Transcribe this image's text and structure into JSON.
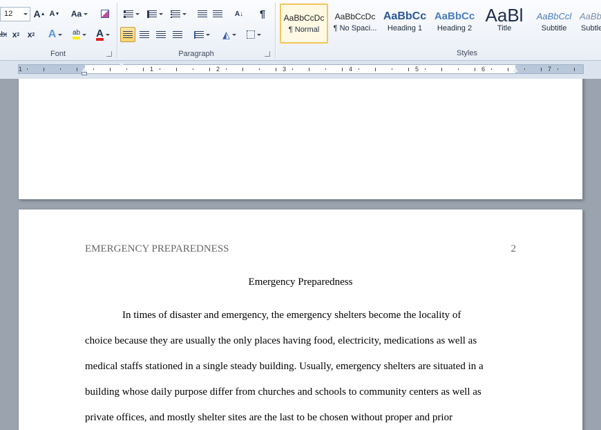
{
  "font_group": {
    "font_size": "12",
    "label": "Font",
    "grow_font": "A",
    "shrink_font": "A",
    "change_case": "Aa",
    "strike": "abc",
    "subscript": "x",
    "superscript": "x",
    "text_effects": "A",
    "highlight": "ab",
    "font_color": "A",
    "highlight_color": "#ffee00",
    "font_color_value": "#e02020"
  },
  "paragraph_group": {
    "label": "Paragraph",
    "pilcrow": "¶",
    "sort": "A↓"
  },
  "styles_group": {
    "label": "Styles",
    "items": [
      {
        "preview": "AaBbCcDc",
        "name": "¶ Normal"
      },
      {
        "preview": "AaBbCcDc",
        "name": "¶ No Spaci..."
      },
      {
        "preview": "AaBbCc",
        "name": "Heading 1"
      },
      {
        "preview": "AaBbCc",
        "name": "Heading 2"
      },
      {
        "preview": "AaBl",
        "name": "Title"
      },
      {
        "preview": "AaBbCcl",
        "name": "Subtitle"
      },
      {
        "preview": "AaBbC",
        "name": "Subtle"
      }
    ]
  },
  "ruler": {
    "numbers": [
      "1",
      "1",
      "2",
      "3",
      "4",
      "5",
      "6",
      "7"
    ]
  },
  "document": {
    "running_head": "EMERGENCY PREPAREDNESS",
    "page_number": "2",
    "title": "Emergency Preparedness",
    "lines": [
      "In times of disaster and emergency, the emergency shelters become the locality of",
      "choice because they are usually the only places having food, electricity, medications as well as",
      "medical staffs stationed in a single steady building. Usually, emergency shelters are situated in a",
      "building whose daily purpose differ from churches and schools to community centers as well as",
      "private offices, and mostly shelter sites are the last to be chosen without proper and prior"
    ]
  }
}
